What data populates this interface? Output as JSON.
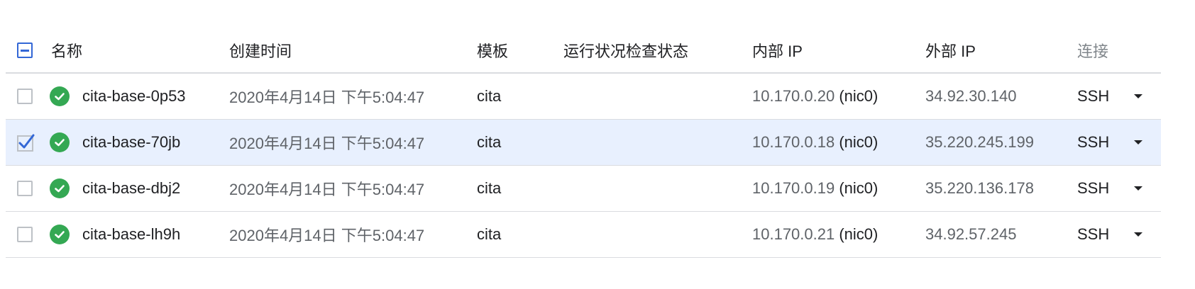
{
  "colors": {
    "accent": "#3367d6",
    "status_ok": "#34a853",
    "selected_row_bg": "#e8f0fe",
    "border": "#dadce0",
    "secondary_text": "#5f6368"
  },
  "table": {
    "columns": {
      "name": "名称",
      "created": "创建时间",
      "template": "模板",
      "health": "运行状况检查状态",
      "internal_ip": "内部 IP",
      "external_ip": "外部 IP",
      "connect": "连接"
    },
    "select_all_state": "indeterminate",
    "rows": [
      {
        "checked": false,
        "status_icon": "check-circle-icon",
        "name": "cita-base-0p53",
        "created": "2020年4月14日 下午5:04:47",
        "template": "cita",
        "health": "",
        "internal_ip": "10.170.0.20",
        "nic": "(nic0)",
        "external_ip": "34.92.30.140",
        "connect": "SSH"
      },
      {
        "checked": true,
        "status_icon": "check-circle-icon",
        "name": "cita-base-70jb",
        "created": "2020年4月14日 下午5:04:47",
        "template": "cita",
        "health": "",
        "internal_ip": "10.170.0.18",
        "nic": "(nic0)",
        "external_ip": "35.220.245.199",
        "connect": "SSH"
      },
      {
        "checked": false,
        "status_icon": "check-circle-icon",
        "name": "cita-base-dbj2",
        "created": "2020年4月14日 下午5:04:47",
        "template": "cita",
        "health": "",
        "internal_ip": "10.170.0.19",
        "nic": "(nic0)",
        "external_ip": "35.220.136.178",
        "connect": "SSH"
      },
      {
        "checked": false,
        "status_icon": "check-circle-icon",
        "name": "cita-base-lh9h",
        "created": "2020年4月14日 下午5:04:47",
        "template": "cita",
        "health": "",
        "internal_ip": "10.170.0.21",
        "nic": "(nic0)",
        "external_ip": "34.92.57.245",
        "connect": "SSH"
      }
    ]
  }
}
